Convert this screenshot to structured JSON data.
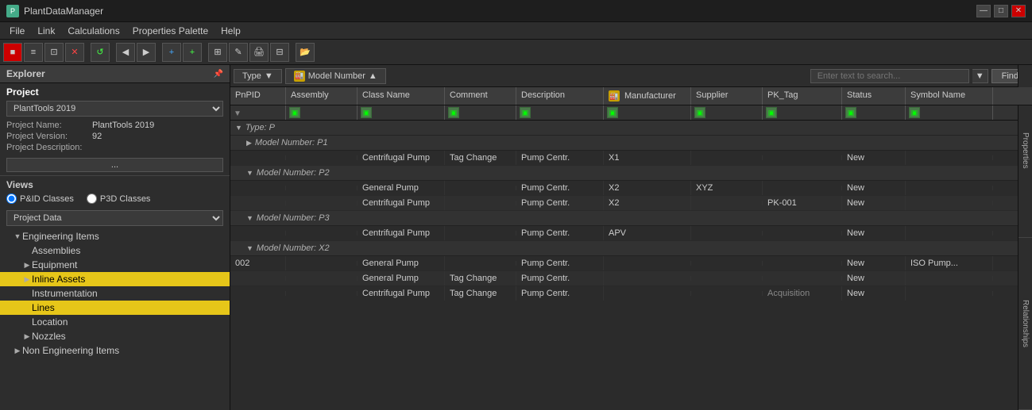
{
  "app": {
    "title": "PlantDataManager",
    "icon": "P"
  },
  "titlebar": {
    "controls": [
      "—",
      "□",
      "✕"
    ]
  },
  "menubar": {
    "items": [
      "File",
      "Link",
      "Calculations",
      "Properties Palette",
      "Help"
    ]
  },
  "toolbar": {
    "buttons": [
      "🔴",
      "≡",
      "⊞",
      "✕",
      "↺",
      "◀",
      "▶",
      "+",
      "++",
      "⊞",
      "✎",
      "🖨",
      "⊟",
      "📂"
    ]
  },
  "explorer": {
    "title": "Explorer",
    "project_section": "Project",
    "project_name_label": "Project Name:",
    "project_name_value": "PlantTools 2019",
    "project_version_label": "Project Version:",
    "project_version_value": "92",
    "project_desc_label": "Project Description:",
    "desc_btn": "...",
    "views_label": "Views",
    "radio1": "P&ID Classes",
    "radio2": "P3D Classes",
    "dropdown": "Project Data",
    "tree": [
      {
        "level": 1,
        "label": "Engineering Items",
        "expanded": true,
        "selected": false
      },
      {
        "level": 2,
        "label": "Assemblies",
        "expanded": false,
        "selected": false
      },
      {
        "level": 2,
        "label": "Equipment",
        "expanded": false,
        "selected": false
      },
      {
        "level": 2,
        "label": "Inline Assets",
        "expanded": false,
        "selected": true
      },
      {
        "level": 2,
        "label": "Instrumentation",
        "expanded": false,
        "selected": false
      },
      {
        "level": 2,
        "label": "Lines",
        "expanded": false,
        "selected": true
      },
      {
        "level": 2,
        "label": "Location",
        "expanded": false,
        "selected": false
      },
      {
        "level": 2,
        "label": "Nozzles",
        "expanded": false,
        "selected": false
      },
      {
        "level": 1,
        "label": "Non Engineering Items",
        "expanded": false,
        "selected": false
      }
    ]
  },
  "grid_toolbar": {
    "type_label": "Type",
    "model_label": "Model Number",
    "search_placeholder": "Enter text to search...",
    "find_btn": "Find"
  },
  "grid": {
    "columns": [
      "PnPID",
      "Assembly",
      "Class Name",
      "Comment",
      "Description",
      "🏭 Manufacturer",
      "Supplier",
      "PK_Tag",
      "Status",
      "Symbol Name"
    ],
    "groups": [
      {
        "label": "Type: P",
        "subgroups": [
          {
            "label": "Model Number: P1",
            "rows": [
              {
                "pnpid": "",
                "assembly": "",
                "classname": "Centrifugal Pump",
                "comment": "Tag Change",
                "description": "Pump Centr.",
                "manufacturer": "X1",
                "supplier": "",
                "pktag": "",
                "status": "New",
                "symbolname": ""
              }
            ]
          },
          {
            "label": "Model Number: P2",
            "rows": [
              {
                "pnpid": "",
                "assembly": "",
                "classname": "General Pump",
                "comment": "",
                "description": "Pump Centr.",
                "manufacturer": "X2",
                "supplier": "XYZ",
                "pktag": "",
                "status": "New",
                "symbolname": ""
              },
              {
                "pnpid": "",
                "assembly": "",
                "classname": "Centrifugal Pump",
                "comment": "",
                "description": "Pump Centr.",
                "manufacturer": "X2",
                "supplier": "",
                "pktag": "PK-001",
                "status": "New",
                "symbolname": ""
              }
            ]
          },
          {
            "label": "Model Number: P3",
            "rows": [
              {
                "pnpid": "",
                "assembly": "",
                "classname": "Centrifugal Pump",
                "comment": "",
                "description": "Pump Centr.",
                "manufacturer": "APV",
                "supplier": "",
                "pktag": "",
                "status": "New",
                "symbolname": ""
              }
            ]
          },
          {
            "label": "Model Number: X2",
            "rows": [
              {
                "pnpid": "002",
                "assembly": "",
                "classname": "General Pump",
                "comment": "",
                "description": "Pump Centr.",
                "manufacturer": "",
                "supplier": "",
                "pktag": "",
                "status": "New",
                "symbolname": "ISO Pump..."
              },
              {
                "pnpid": "",
                "assembly": "",
                "classname": "General Pump",
                "comment": "Tag Change",
                "description": "Pump Centr.",
                "manufacturer": "",
                "supplier": "",
                "pktag": "",
                "status": "New",
                "symbolname": ""
              },
              {
                "pnpid": "",
                "assembly": "",
                "classname": "Centrifugal Pump",
                "comment": "Tag Change",
                "description": "Pump Centr.",
                "manufacturer": "",
                "supplier": "",
                "pktag": "Acquisition",
                "status": "New",
                "symbolname": ""
              }
            ]
          }
        ]
      }
    ]
  },
  "side_tabs": [
    "Properties",
    "Relationships"
  ]
}
